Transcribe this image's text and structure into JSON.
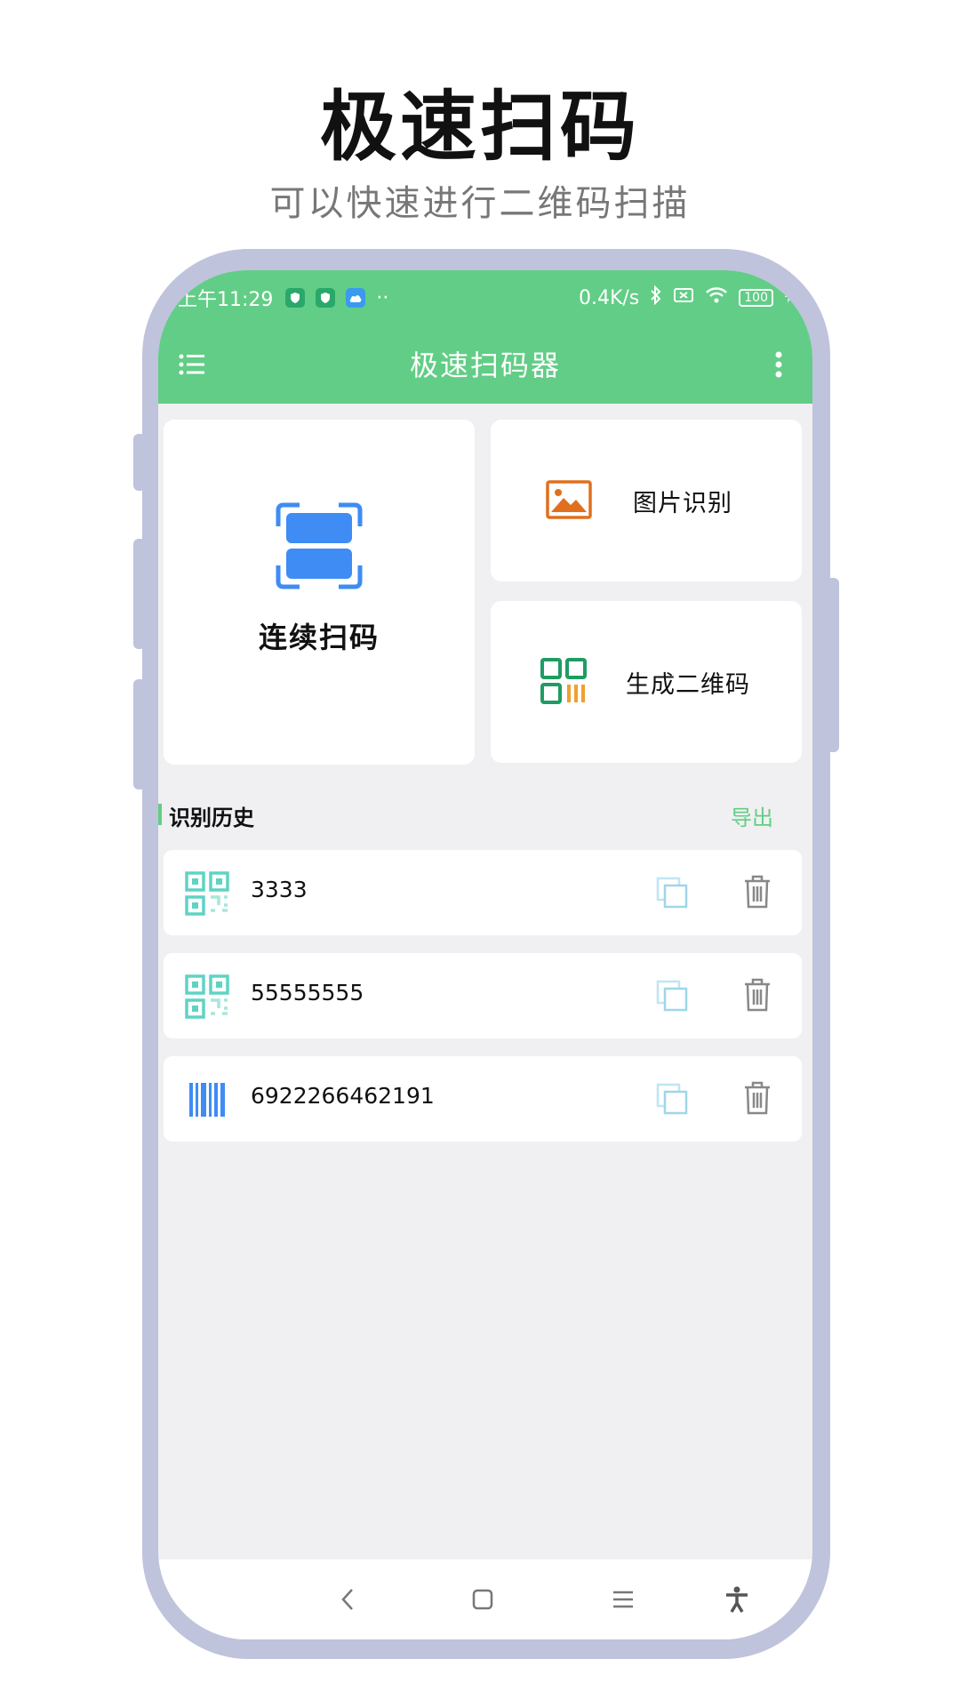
{
  "hero": {
    "title": "极速扫码",
    "subtitle": "可以快速进行二维码扫描"
  },
  "status_bar": {
    "time": "上午11:29",
    "dots": "··",
    "speed": "0.4K/s",
    "battery": "100"
  },
  "toolbar": {
    "title": "极速扫码器",
    "menu_icon": "list-icon",
    "more_icon": "more-vertical-icon"
  },
  "actions": {
    "continuous_scan": "连续扫码",
    "image_recognize": "图片识别",
    "generate_qr": "生成二维码"
  },
  "history": {
    "title": "识别历史",
    "export_label": "导出",
    "items": [
      {
        "value": "3333",
        "type": "qr"
      },
      {
        "value": "55555555",
        "type": "qr"
      },
      {
        "value": "6922266462191",
        "type": "barcode"
      }
    ]
  },
  "colors": {
    "accent": "#62cd86",
    "scan_blue": "#3e8cf4",
    "image_orange": "#e0701f",
    "qr_teal": "#5fd3c4"
  }
}
